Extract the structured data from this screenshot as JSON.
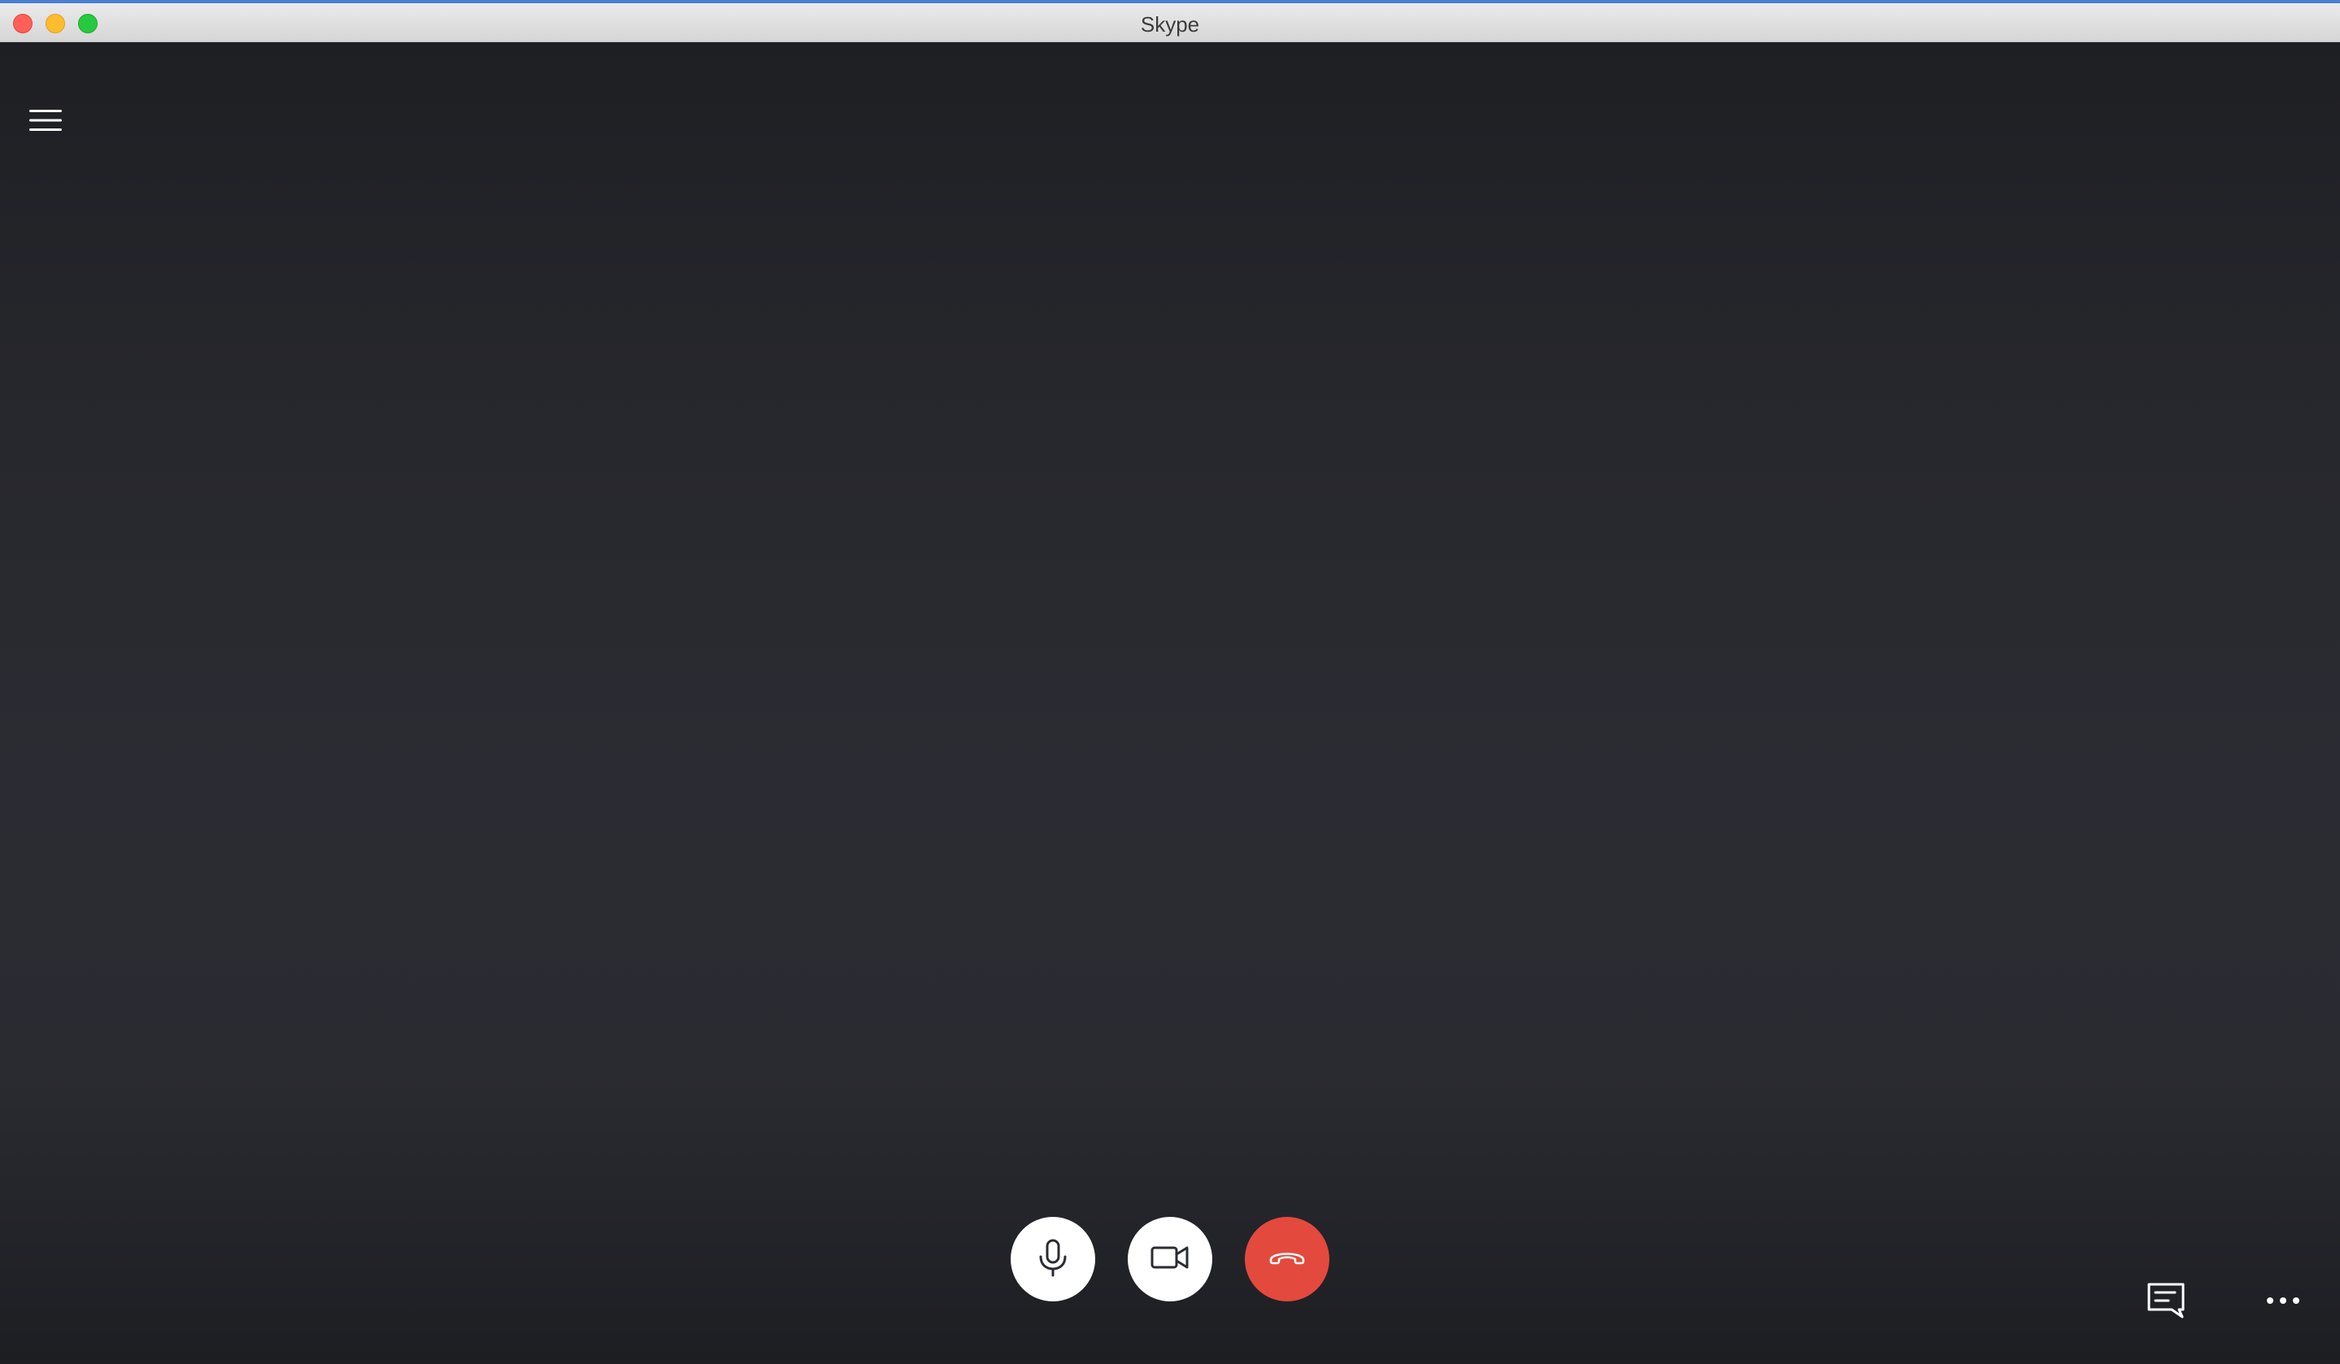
{
  "window": {
    "title": "Skype"
  },
  "icons": {
    "menu": "hamburger-menu-icon",
    "microphone": "microphone-icon",
    "video": "video-camera-icon",
    "hangup": "end-call-phone-icon",
    "chat": "chat-bubble-icon",
    "more": "more-options-ellipsis-icon"
  },
  "colors": {
    "background": "#2a2b31",
    "hangup": "#e4493d",
    "control_button": "#ffffff"
  }
}
